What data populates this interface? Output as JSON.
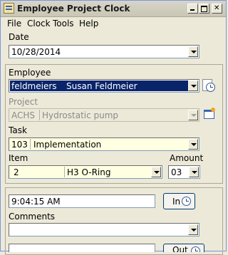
{
  "window": {
    "title": "Employee Project Clock"
  },
  "menu": [
    "File",
    "Clock",
    "Tools",
    "Help"
  ],
  "date": {
    "label": "Date",
    "value": "10/28/2014"
  },
  "employee": {
    "label": "Employee",
    "id": "feldmeiers",
    "name": "Susan Feldmeier"
  },
  "project": {
    "label": "Project",
    "code": "ACHS",
    "name": "Hydrostatic pump"
  },
  "task": {
    "label": "Task",
    "code": "103",
    "name": "Implementation"
  },
  "item": {
    "label": "Item",
    "code": "2",
    "name": "H3 O-Ring"
  },
  "amount": {
    "label": "Amount",
    "value": "03"
  },
  "time": {
    "value": "9:04:15 AM"
  },
  "in_button": {
    "label": "In"
  },
  "comments": {
    "label": "Comments",
    "value": ""
  },
  "out_button": {
    "label": "Out"
  },
  "icons": [
    "clock-icon",
    "edit-project-icon",
    "dropdown-arrow-icon",
    "minimize-icon",
    "maximize-icon",
    "close-icon"
  ],
  "colors": {
    "selection": "#0a246a",
    "input_highlight": "#ffffe1",
    "window_bg": "#ece9d8"
  }
}
